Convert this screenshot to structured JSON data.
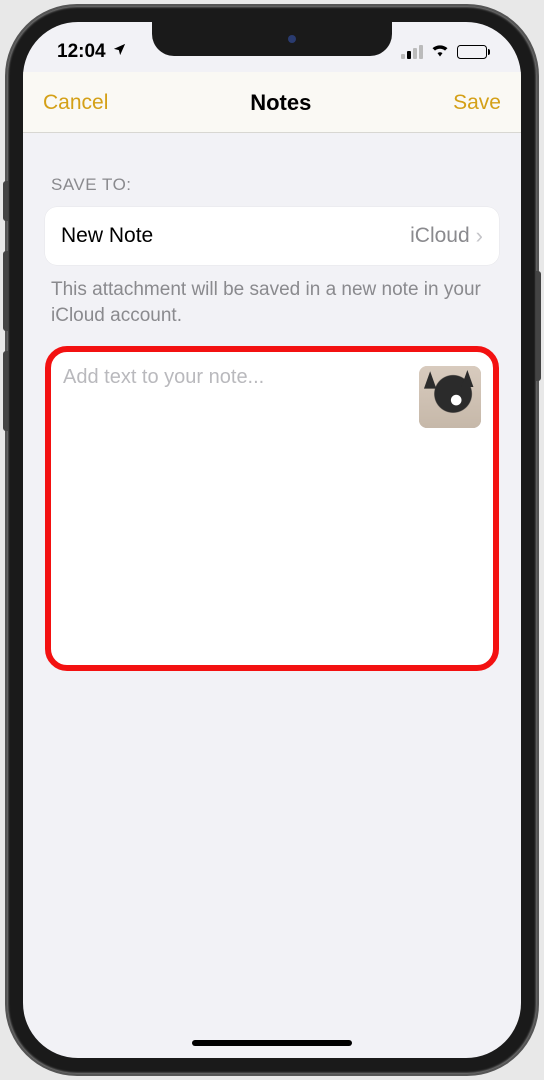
{
  "status": {
    "time": "12:04",
    "location_icon": "location-arrow"
  },
  "nav": {
    "cancel": "Cancel",
    "title": "Notes",
    "save": "Save"
  },
  "section": {
    "label": "SAVE TO:",
    "destination_title": "New Note",
    "destination_account": "iCloud",
    "helper": "This attachment will be saved in a new note in your iCloud account."
  },
  "note": {
    "placeholder": "Add text to your note...",
    "attachment_name": "photo-thumbnail"
  },
  "accent_color": "#d4a017"
}
